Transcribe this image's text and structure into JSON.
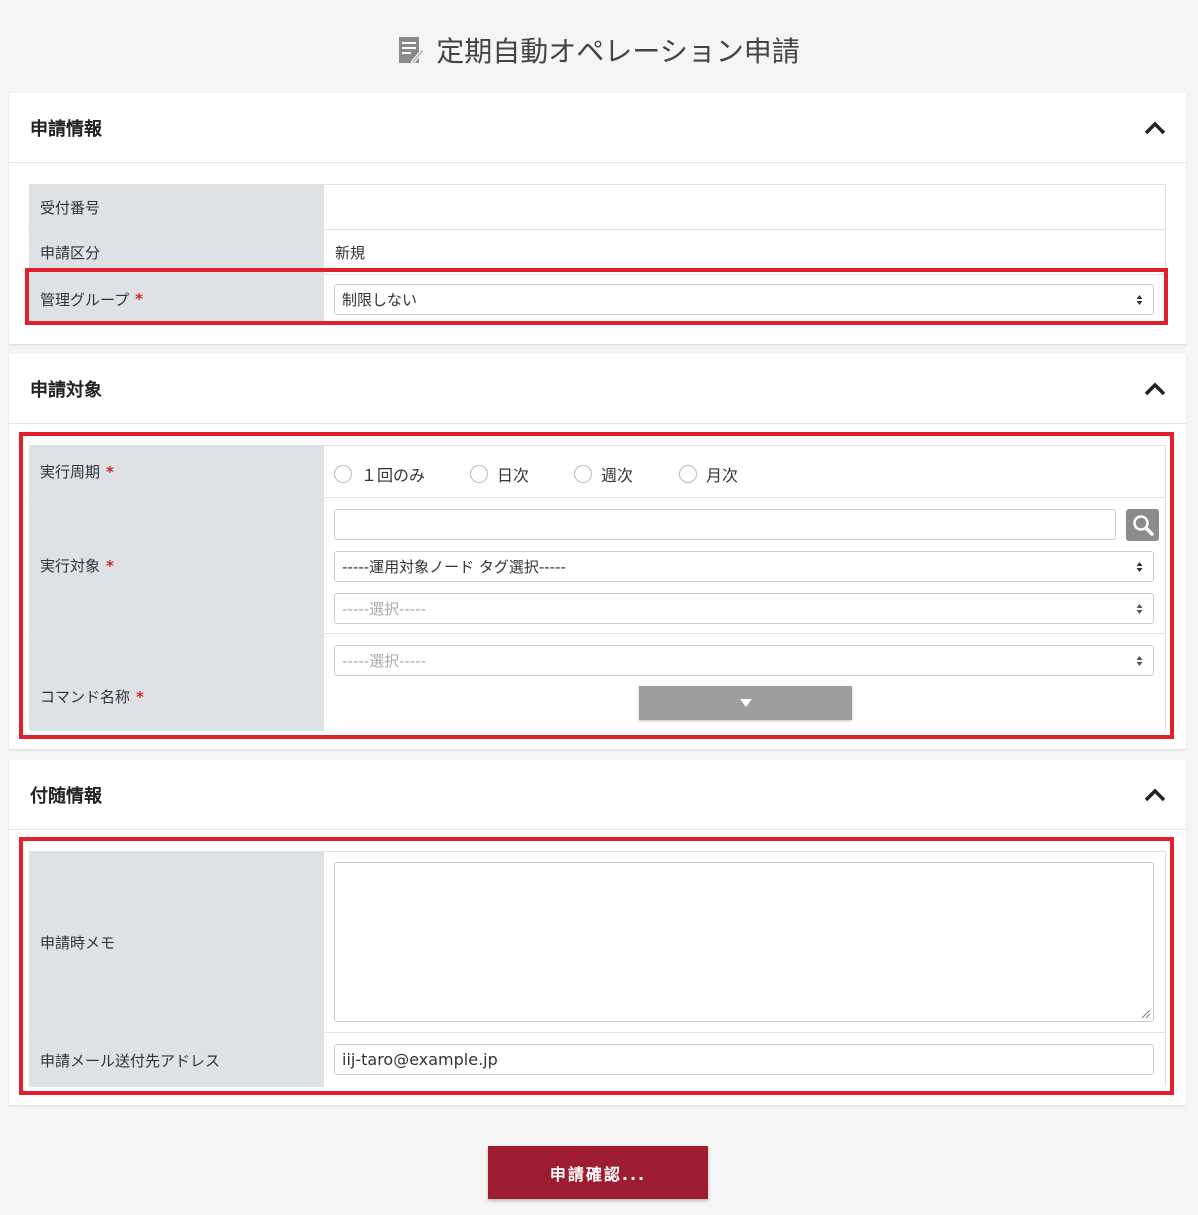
{
  "page": {
    "title": "定期自動オペレーション申請",
    "title_icon": "document-edit-icon"
  },
  "sections": {
    "application_info": {
      "title": "申請情報",
      "rows": {
        "receipt_number": {
          "label": "受付番号",
          "value": ""
        },
        "application_type": {
          "label": "申請区分",
          "value": "新規"
        },
        "management_group": {
          "label": "管理グループ",
          "required": "*",
          "selected": "制限しない"
        }
      }
    },
    "application_target": {
      "title": "申請対象",
      "rows": {
        "execution_cycle": {
          "label": "実行周期",
          "required": "*",
          "options": [
            "１回のみ",
            "日次",
            "週次",
            "月次"
          ]
        },
        "execution_target": {
          "label": "実行対象",
          "required": "*",
          "search_value": "",
          "node_tag_select": "-----運用対象ノード タグ選択-----",
          "select_placeholder": "-----選択-----"
        },
        "command_name": {
          "label": "コマンド名称",
          "required": "*",
          "select_placeholder": "-----選択-----"
        }
      }
    },
    "additional_info": {
      "title": "付随情報",
      "rows": {
        "memo": {
          "label": "申請時メモ",
          "value": ""
        },
        "mail_address": {
          "label": "申請メール送付先アドレス",
          "value": "iij-taro@example.jp"
        }
      }
    }
  },
  "submit_label": "申請確認...",
  "colors": {
    "accent": "#9e1c2f",
    "highlight_frame": "#e0202c",
    "label_bg": "#dee2e4",
    "required": "#d3232a"
  }
}
